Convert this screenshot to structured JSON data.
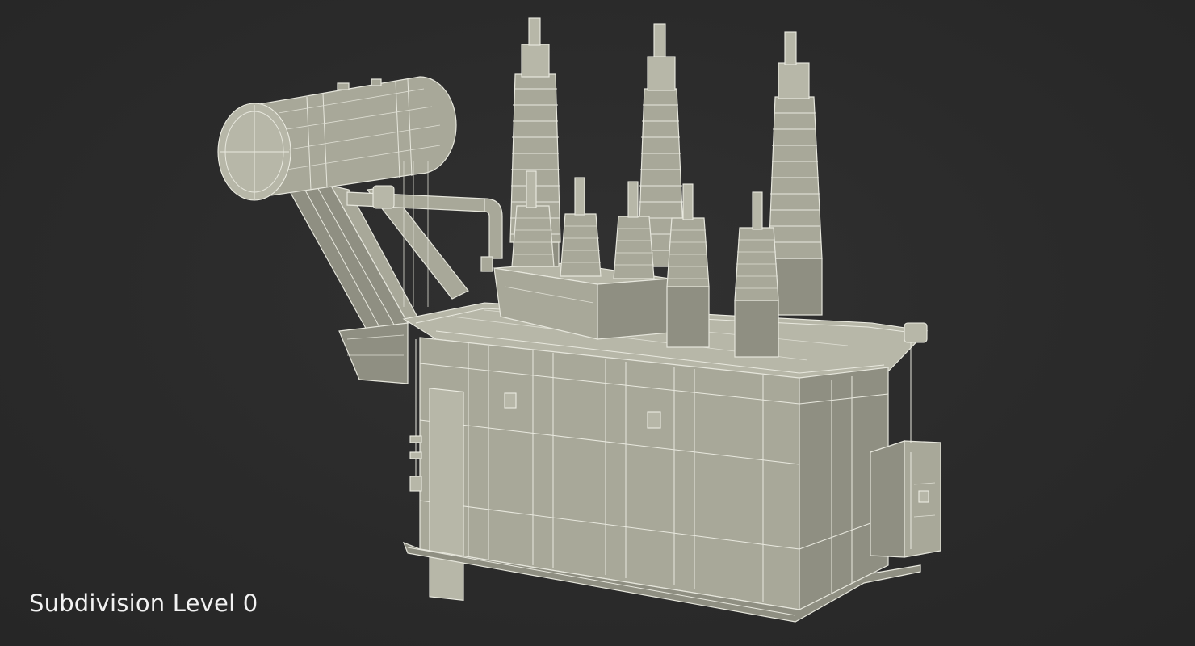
{
  "viewport": {
    "label": "Subdivision Level 0",
    "background": "#2b2b2b",
    "model_color": "#a8a899",
    "wire_color": "#e6e6dc",
    "subject": "transformer-wireframe-model"
  }
}
